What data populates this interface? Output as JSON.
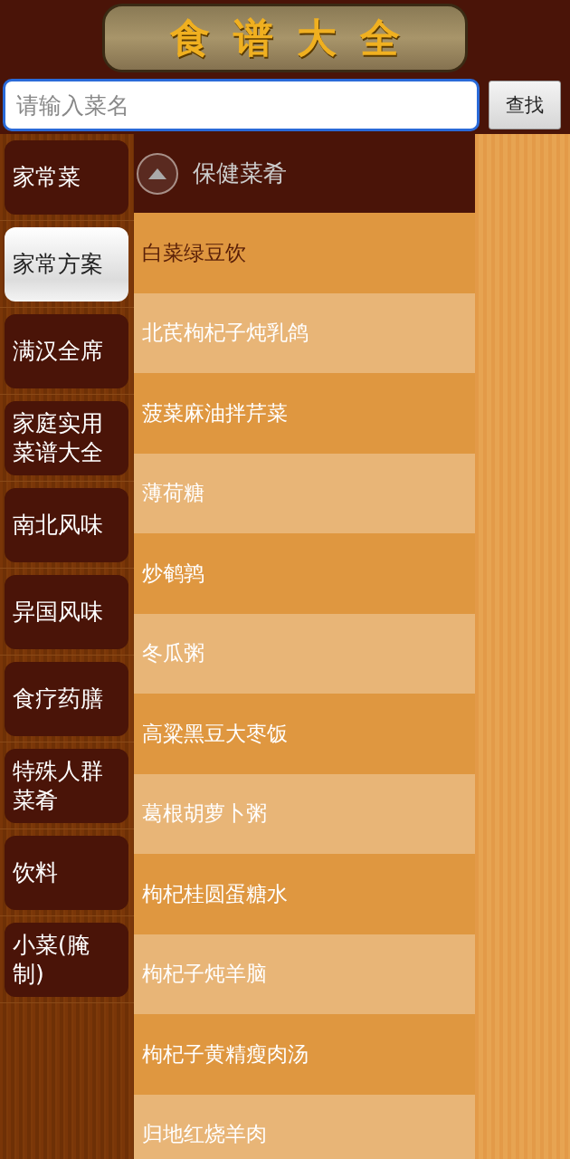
{
  "logo": {
    "title": "食谱大全"
  },
  "search": {
    "placeholder": "请输入菜名",
    "button": "查找"
  },
  "sidebar": {
    "items": [
      {
        "label": "家常菜",
        "selected": false
      },
      {
        "label": "家常方案",
        "selected": true
      },
      {
        "label": "满汉全席",
        "selected": false
      },
      {
        "label": "家庭实用菜谱大全",
        "selected": false
      },
      {
        "label": "南北风味",
        "selected": false
      },
      {
        "label": "异国风味",
        "selected": false
      },
      {
        "label": "食疗药膳",
        "selected": false
      },
      {
        "label": "特殊人群菜肴",
        "selected": false
      },
      {
        "label": "饮料",
        "selected": false
      },
      {
        "label": "小菜(腌制)",
        "selected": false
      }
    ]
  },
  "section": {
    "title": "保健菜肴",
    "expanded": true
  },
  "recipes": [
    {
      "name": "白菜绿豆饮",
      "selected": true
    },
    {
      "name": "北芪枸杞子炖乳鸽",
      "selected": false
    },
    {
      "name": "菠菜麻油拌芹菜",
      "selected": false
    },
    {
      "name": "薄荷糖",
      "selected": false
    },
    {
      "name": "炒鹌鹑",
      "selected": false
    },
    {
      "name": "冬瓜粥",
      "selected": false
    },
    {
      "name": "高粱黑豆大枣饭",
      "selected": false
    },
    {
      "name": "葛根胡萝卜粥",
      "selected": false
    },
    {
      "name": "枸杞桂圆蛋糖水",
      "selected": false
    },
    {
      "name": "枸杞子炖羊脑",
      "selected": false
    },
    {
      "name": "枸杞子黄精瘦肉汤",
      "selected": false
    },
    {
      "name": "归地红烧羊肉",
      "selected": false
    }
  ]
}
